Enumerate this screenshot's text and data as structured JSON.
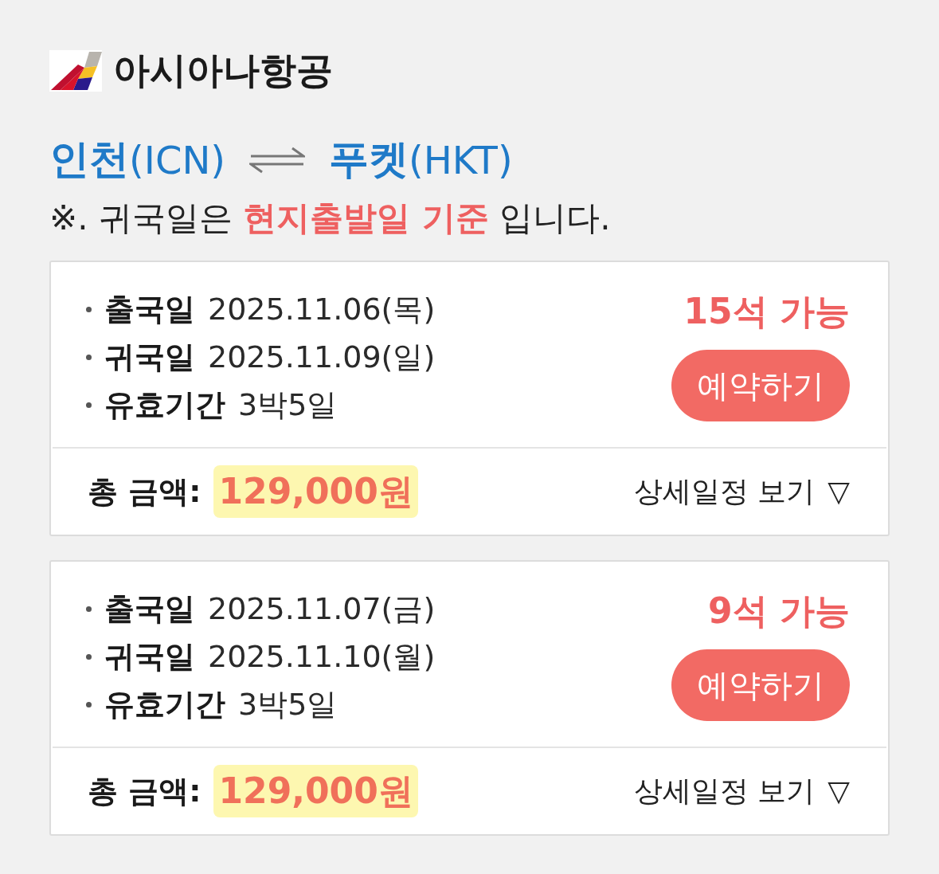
{
  "airline": {
    "name": "아시아나항공"
  },
  "route": {
    "from": {
      "city": "인천",
      "code": "(ICN)"
    },
    "to": {
      "city": "푸켓",
      "code": "(HKT)"
    }
  },
  "notice": "※. 귀국일은 **현지출발일 기준** 입니다.",
  "flights": [
    {
      "details": [
        {
          "label": "출국일",
          "value": "2025.11.06(목)"
        },
        {
          "label": "귀국일",
          "value": "2025.11.09(일)"
        },
        {
          "label": "유효기간",
          "value": "3박5일"
        }
      ],
      "seats": "15석 가능",
      "book_button": "예약하기",
      "total_label": "총 금액:",
      "total": "129,000원",
      "highlighted": true,
      "detail_link": "상세일정 보기",
      "detail_icon": "▽"
    },
    {
      "details": [
        {
          "label": "출국일",
          "value": "2025.11.07(금)"
        },
        {
          "label": "귀국일",
          "value": "2025.11.10(월)"
        },
        {
          "label": "유효기간",
          "value": "3박5일"
        }
      ],
      "seats": "9석 가능",
      "book_button": "예약하기",
      "total_label": "총 금액:",
      "total": "129,000원",
      "highlighted": true,
      "detail_link": "상세일정 보기",
      "detail_icon": "▽"
    }
  ]
}
